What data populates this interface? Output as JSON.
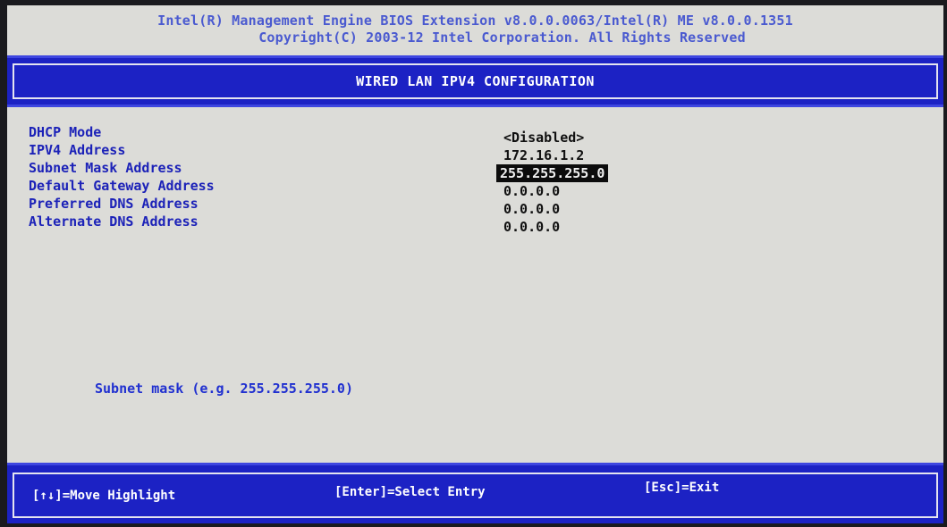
{
  "header": {
    "line1": "Intel(R) Management Engine BIOS Extension v8.0.0.0063/Intel(R) ME v8.0.0.1351",
    "line2": "Copyright(C) 2003-12 Intel Corporation. All Rights Reserved"
  },
  "title": "WIRED LAN IPV4 CONFIGURATION",
  "fields": [
    {
      "label": "DHCP Mode",
      "value": "<Disabled>"
    },
    {
      "label": "IPV4 Address",
      "value": "172.16.1.2"
    },
    {
      "label": "Subnet Mask Address",
      "value": "255.255.255.0",
      "selected": true
    },
    {
      "label": "Default Gateway Address",
      "value": "0.0.0.0"
    },
    {
      "label": "Preferred DNS Address",
      "value": "0.0.0.0"
    },
    {
      "label": "Alternate DNS Address",
      "value": "0.0.0.0"
    }
  ],
  "help_text": "Subnet mask (e.g. 255.255.255.0)",
  "footer": {
    "move": "[↑↓]=Move Highlight",
    "select": "[Enter]=Select Entry",
    "exit": "[Esc]=Exit"
  },
  "colors": {
    "title_bar": "#1c22c4",
    "label_text": "#1c22b8",
    "background": "#dcdcd8",
    "highlight_bg": "#0c0c0c"
  }
}
